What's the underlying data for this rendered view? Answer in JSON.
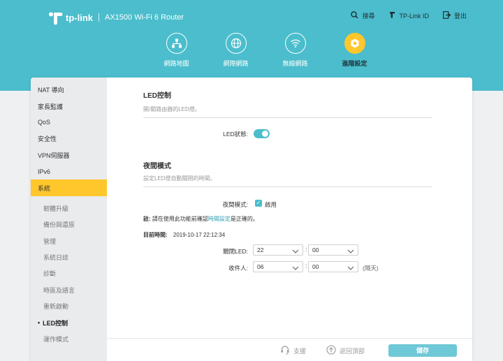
{
  "header": {
    "brand": "tp-link",
    "model": "AX1500 Wi-Fi 6 Router",
    "links": {
      "search": "搜尋",
      "tplink_id": "TP-Link ID",
      "logout": "登出"
    }
  },
  "nav": {
    "items": [
      {
        "label": "網路地圖"
      },
      {
        "label": "網際網路"
      },
      {
        "label": "無線網路"
      },
      {
        "label": "進階設定"
      }
    ]
  },
  "sidebar": {
    "items": [
      {
        "label": "NAT 導向"
      },
      {
        "label": "家長監護"
      },
      {
        "label": "QoS"
      },
      {
        "label": "安全性"
      },
      {
        "label": "VPN伺服器"
      },
      {
        "label": "IPv6"
      },
      {
        "label": "系統"
      }
    ],
    "sub": [
      {
        "label": "韌體升級"
      },
      {
        "label": "備份與還原"
      },
      {
        "label": "管理"
      },
      {
        "label": "系統日誌"
      },
      {
        "label": "診斷"
      },
      {
        "label": "時區及語言"
      },
      {
        "label": "重新啟動"
      },
      {
        "label": "LED控制"
      },
      {
        "label": "運作模式"
      }
    ]
  },
  "led": {
    "title": "LED控制",
    "desc": "開/關路由器的LED燈。",
    "status_label": "LED狀態:"
  },
  "night": {
    "title": "夜間模式",
    "desc": "設定LED燈自動關閉的時間。",
    "mode_label": "夜間模式:",
    "enable_label": "啟用",
    "note_prefix": "註:",
    "note_before": " 請在使用此功能前確認",
    "note_link": "時間設定",
    "note_after": "是正確的。",
    "time_label": "目前時間:",
    "time_value": "2019-10-17 22:12:34",
    "off_label": "關閉LED:",
    "off_hour": "22",
    "off_min": "00",
    "on_label": "收件人:",
    "on_hour": "06",
    "on_min": "00",
    "next_day": "(隔天)"
  },
  "footer": {
    "support": "支援",
    "top": "返回頂部",
    "save": "儲存"
  }
}
